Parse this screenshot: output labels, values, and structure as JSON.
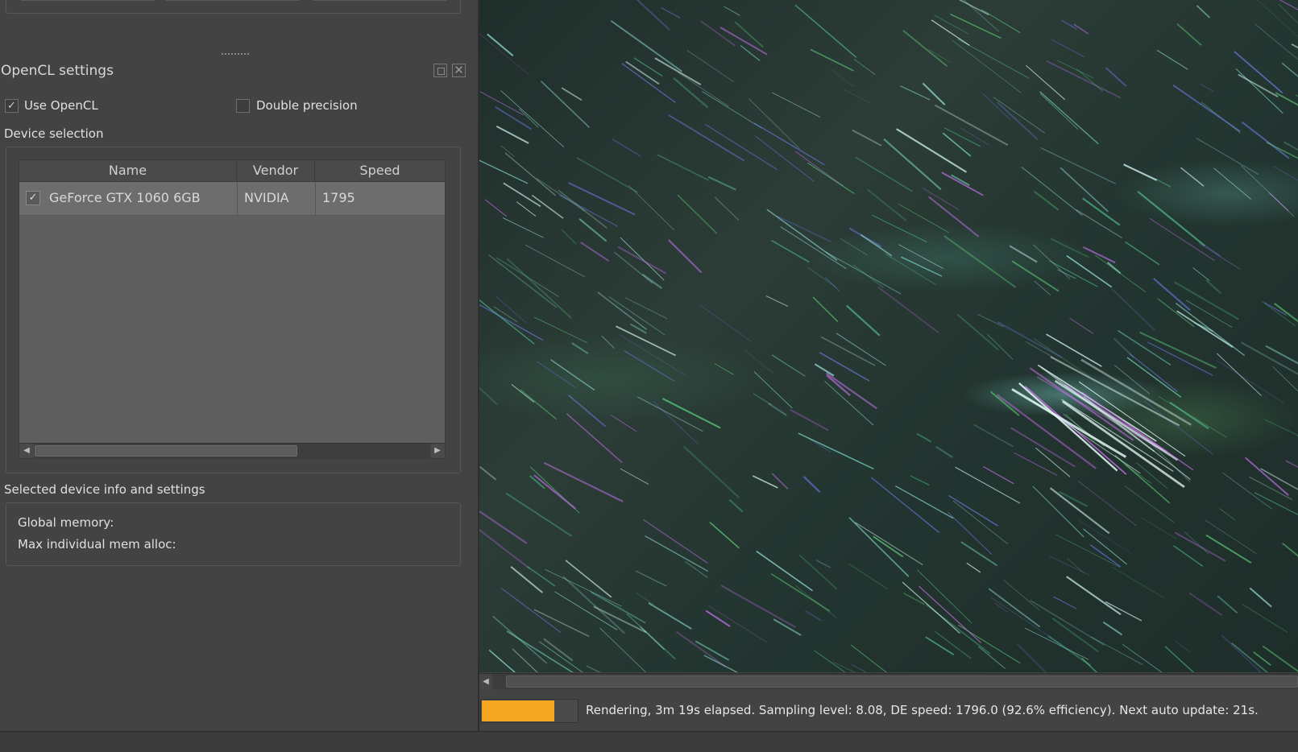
{
  "dock": {
    "title": "OpenCL settings",
    "float_icon": "float-window-icon",
    "close_icon": "close-icon",
    "close_glyph": "✕"
  },
  "options": {
    "use_opencl": {
      "label": "Use OpenCL",
      "checked": true
    },
    "double_precision": {
      "label": "Double precision",
      "checked": false
    },
    "check_glyph": "✓"
  },
  "device_selection": {
    "title": "Device selection",
    "columns": [
      "Name",
      "Vendor",
      "Speed"
    ],
    "rows": [
      {
        "checked": true,
        "name": "GeForce GTX 1060 6GB",
        "vendor": "NVIDIA",
        "speed": "1795"
      }
    ],
    "scroll_left_glyph": "◀",
    "scroll_right_glyph": "▶"
  },
  "device_info": {
    "title": "Selected device info and settings",
    "global_memory_label": "Global memory:",
    "max_alloc_label": "Max individual mem alloc:"
  },
  "render": {
    "scroll_left_glyph": "◀"
  },
  "status": {
    "progress_fraction": 0.76,
    "progress_color": "#f5a623",
    "text": "Rendering, 3m 19s elapsed. Sampling level: 8.08, DE speed: 1796.0 (92.6% efficiency). Next auto update: 21s."
  }
}
